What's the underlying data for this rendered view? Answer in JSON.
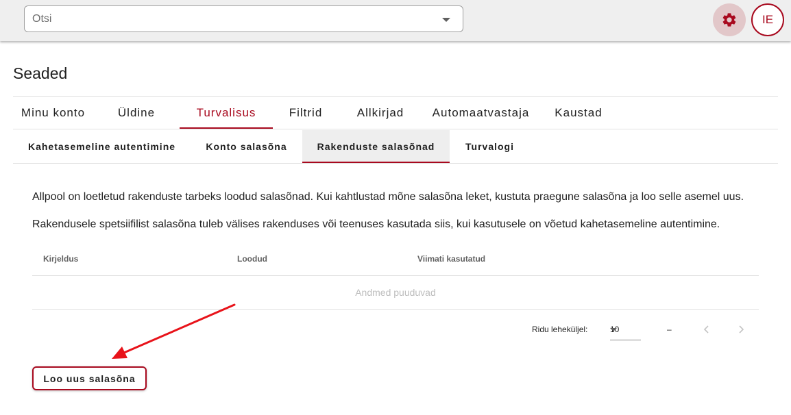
{
  "header": {
    "search_placeholder": "Otsi",
    "settings_icon": "gear-icon",
    "avatar_initials": "IE"
  },
  "page": {
    "title": "Seaded"
  },
  "tabs": [
    {
      "label": "Minu konto",
      "active": false
    },
    {
      "label": "Üldine",
      "active": false
    },
    {
      "label": "Turvalisus",
      "active": true
    },
    {
      "label": "Filtrid",
      "active": false
    },
    {
      "label": "Allkirjad",
      "active": false
    },
    {
      "label": "Automaatvastaja",
      "active": false
    },
    {
      "label": "Kaustad",
      "active": false
    }
  ],
  "subtabs": [
    {
      "label": "Kahetasemeline autentimine",
      "active": false
    },
    {
      "label": "Konto salasõna",
      "active": false
    },
    {
      "label": "Rakenduste salasõnad",
      "active": true
    },
    {
      "label": "Turvalogi",
      "active": false
    }
  ],
  "content": {
    "paragraph1": "Allpool on loetletud rakenduste tarbeks loodud salasõnad. Kui kahtlustad mõne salasõna leket, kustuta praegune salasõna ja loo selle asemel uus.",
    "paragraph2": "Rakendusele spetsiifilist salasõna tuleb välises rakenduses või teenuses kasutada siis, kui kasutusele on võetud kahetasemeline autentimine."
  },
  "table": {
    "columns": [
      "Kirjeldus",
      "Loodud",
      "Viimati kasutatud"
    ],
    "rows": [],
    "empty_text": "Andmed puuduvad"
  },
  "pagination": {
    "rows_label": "Ridu leheküljel:",
    "rows_per_page": "10",
    "range": "–"
  },
  "actions": {
    "create_label": "Loo uus salasõna"
  },
  "colors": {
    "accent": "#a8091e",
    "annotation_arrow": "#e8131a"
  }
}
